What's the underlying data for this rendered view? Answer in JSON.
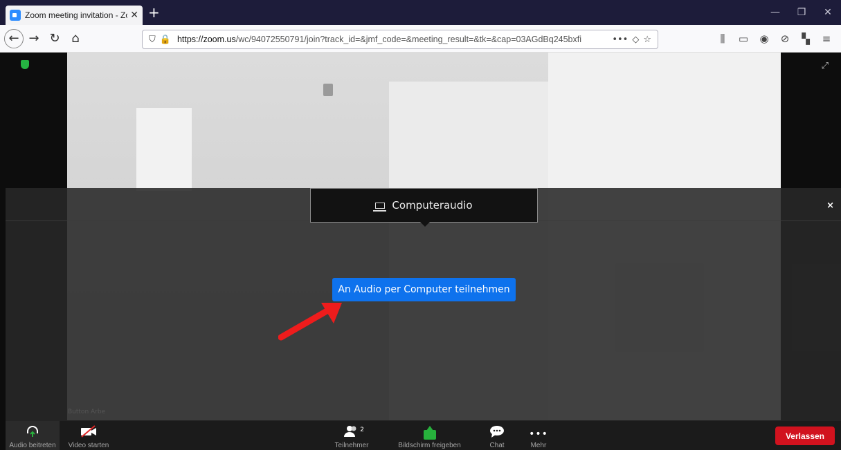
{
  "browser": {
    "tab_title": "Zoom meeting invitation - Zoo",
    "url_host": "https://zoom.us",
    "url_path": "/wc/94072550791/join?track_id=&jmf_code=&meeting_result=&tk=&cap=03AGdBq245bxfi",
    "icons": {
      "back": "←",
      "forward": "→",
      "reload": "↻",
      "home": "⌂",
      "more": "•••",
      "pocket": "◇",
      "star": "☆",
      "library": "⫼",
      "sidebar": "▭",
      "account": "◉",
      "block": "⊘",
      "ext": "▚",
      "menu": "≡",
      "new_tab": "+",
      "tab_close": "✕",
      "minimize": "—",
      "restore": "❐",
      "close": "✕"
    }
  },
  "meeting": {
    "audio_tab_label": "Computeraudio",
    "join_audio_button": "An Audio per Computer teilnehmen",
    "close_symbol": "×",
    "fullscreen_symbol": "⤢",
    "ghost_label": "Button Arbe"
  },
  "toolbar": {
    "audio_label": "Audio beitreten",
    "video_label": "Video starten",
    "participants_label": "Teilnehmer",
    "participants_count": "2",
    "share_label": "Bildschirm freigeben",
    "chat_label": "Chat",
    "more_label": "Mehr",
    "leave_label": "Verlassen",
    "icons": {
      "audio": "⌒",
      "video": "▰",
      "participants": "👥",
      "chat": "💬",
      "more": "•••"
    }
  },
  "colors": {
    "accent_blue": "#0e72ed",
    "leave_red": "#d1121e",
    "share_green": "#27b13c",
    "tabbar": "#1d1c3a"
  }
}
